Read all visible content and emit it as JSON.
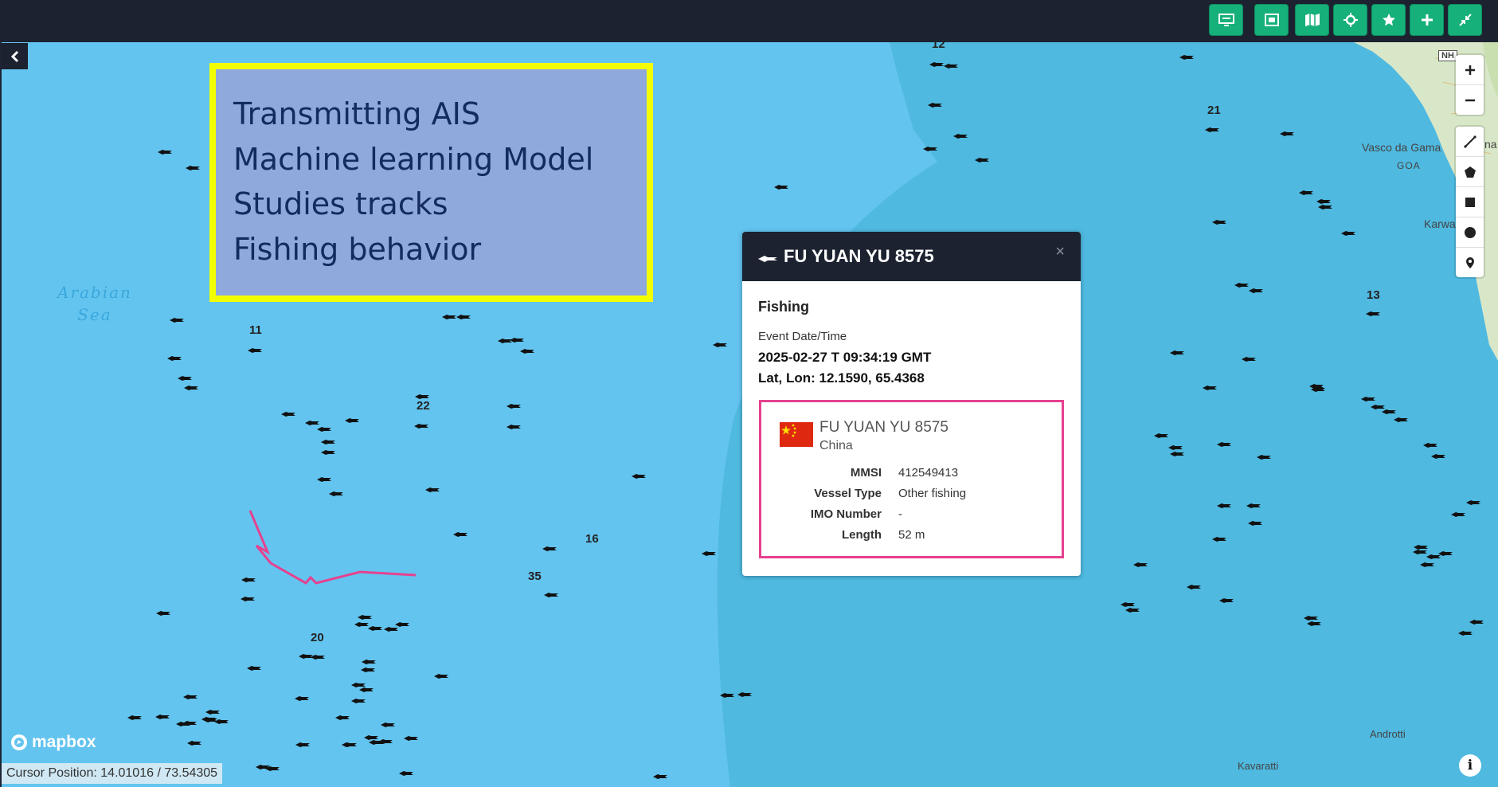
{
  "toolbar": {
    "buttons": [
      {
        "icon": "layout-icon"
      },
      {
        "icon": "fit-frame-icon"
      },
      {
        "icon": "map-icon"
      },
      {
        "icon": "target-icon"
      },
      {
        "icon": "star-icon"
      },
      {
        "icon": "plus-icon"
      },
      {
        "icon": "collapse-arrows-icon"
      }
    ]
  },
  "annotation": {
    "lines": [
      "Transmitting AIS",
      "Machine learning Model",
      "Studies tracks",
      "Fishing behavior"
    ]
  },
  "map": {
    "sea_label_line1": "Arabian",
    "sea_label_line2": "Sea",
    "cluster_labels": [
      "12",
      "21",
      "11",
      "22",
      "13",
      "16",
      "35",
      "20"
    ],
    "places": {
      "vasco": "Vasco da Gama",
      "goa": "GOA",
      "karwar": "Karwa",
      "go": "Go",
      "ma": "na",
      "nh": "NH",
      "androtti": "Androtti",
      "kavaratti": "Kavaratti"
    },
    "colors": {
      "sea": "#63c4ef",
      "deep_sea": "#4fb9e0",
      "track": "#e6418f"
    }
  },
  "popup": {
    "title": "FU YUAN YU 8575",
    "close": "×",
    "status": "Fishing",
    "event_label": "Event Date/Time",
    "event_value": "2025-02-27 T 09:34:19 GMT",
    "latlon": "Lat, Lon: 12.1590, 65.4368",
    "card": {
      "name": "FU YUAN YU 8575",
      "country": "China",
      "rows": [
        {
          "key": "MMSI",
          "value": "412549413"
        },
        {
          "key": "Vessel Type",
          "value": "Other fishing"
        },
        {
          "key": "IMO Number",
          "value": "-"
        },
        {
          "key": "Length",
          "value": "52 m"
        }
      ]
    }
  },
  "controls": {
    "zoom": [
      "zoom-in-icon",
      "zoom-out-icon"
    ],
    "draw": [
      "line-tool-icon",
      "polygon-tool-icon",
      "rectangle-tool-icon",
      "circle-tool-icon",
      "marker-tool-icon"
    ]
  },
  "footer": {
    "mapbox": "mapbox",
    "cursor": "Cursor Position: 14.01016 / 73.54305",
    "info": "i"
  }
}
